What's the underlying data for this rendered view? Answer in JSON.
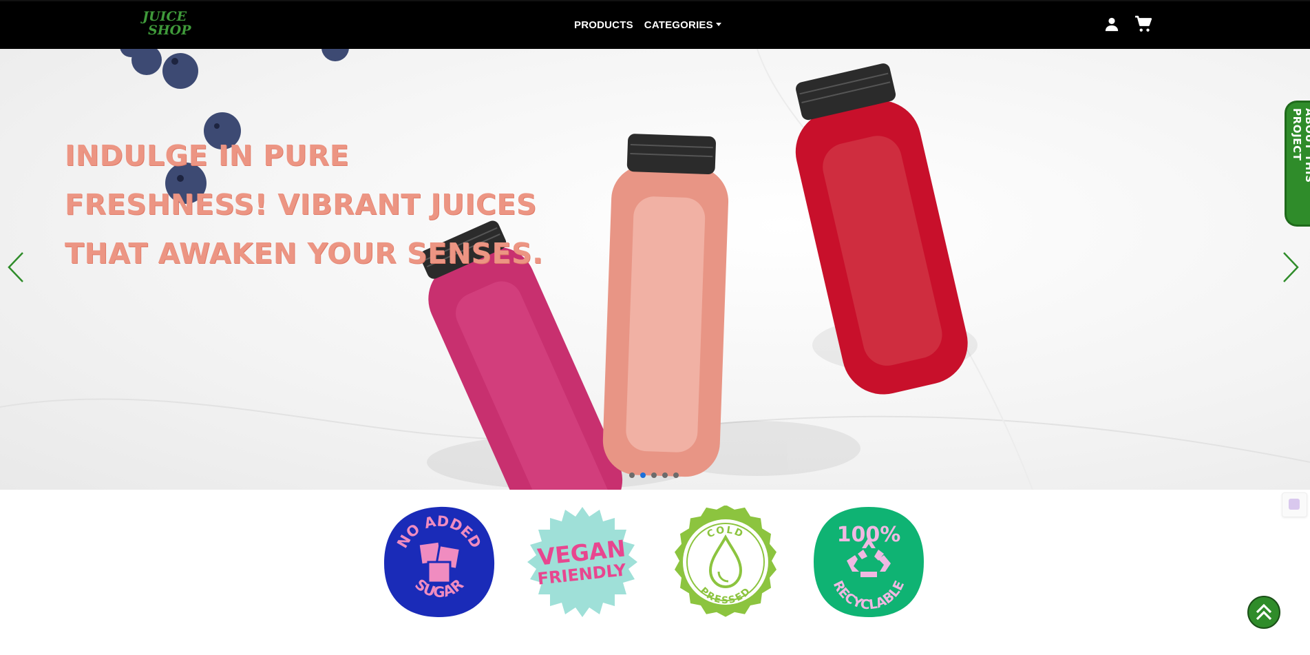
{
  "brand": {
    "logo_line1": "JUICE",
    "logo_line2": "SHOP"
  },
  "nav": {
    "products_label": "PRODUCTS",
    "categories_label": "CATEGORIES",
    "user_icon": "person-icon",
    "cart_icon": "shopping-cart-icon"
  },
  "hero": {
    "headline": "Indulge in pure freshness! Vibrant juices that awaken your senses.",
    "slide_count": 5,
    "active_slide": 2,
    "prev_icon": "chevron-left-icon",
    "next_icon": "chevron-right-icon"
  },
  "side_tab": {
    "label": "ABOUT THIS PROJECT"
  },
  "badges": [
    {
      "line1": "NO ADDED",
      "line2": "SUGAR",
      "icon": "sugar-cubes-icon",
      "color": "#1a2bb8"
    },
    {
      "line1": "VEGAN",
      "line2": "FRIENDLY",
      "icon": "starburst-badge",
      "color": "#9fe0d8"
    },
    {
      "line1": "COLD",
      "line2": "PRESSED",
      "icon": "water-drop-icon",
      "color": "#8cc43f"
    },
    {
      "line1": "100%",
      "line2": "RECYCLABLE",
      "icon": "recycle-icon",
      "color": "#0fb373"
    }
  ],
  "colors": {
    "accent_green": "#2f8c2a",
    "headline": "#ec9583",
    "badge_pink": "#f08cc0",
    "navbar": "#000000"
  },
  "scroll_top_icon": "double-chevron-up-icon",
  "widget_icon": "assistant-icon"
}
